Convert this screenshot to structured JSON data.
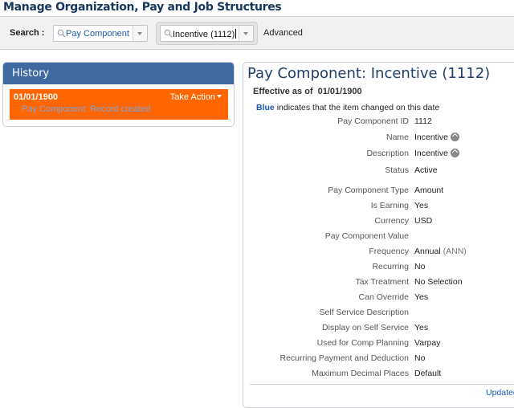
{
  "page": {
    "title": "Manage Organization, Pay and Job Structures"
  },
  "search": {
    "label": "Search :",
    "type_value": "Pay Component",
    "item_value": "Incentive (1112)",
    "advanced_label": "Advanced"
  },
  "history": {
    "title": "History",
    "entry": {
      "date": "01/01/1900",
      "action_label": "Take Action",
      "description": "Pay Component: Record created"
    }
  },
  "detail": {
    "title": "Pay Component: Incentive (1112)",
    "effective_label": "Effective as of",
    "effective_date": "01/01/1900",
    "legend_blue": "Blue",
    "legend_text": "indicates that the item changed on this date",
    "rows": [
      {
        "label": "Pay Component ID",
        "value": "1112"
      },
      {
        "label": "Name",
        "value": "Incentive"
      },
      {
        "label": "Description",
        "value": "Incentive"
      },
      {
        "label": "Status",
        "value": "Active"
      },
      {
        "label": "Pay Component Type",
        "value": "Amount"
      },
      {
        "label": "Is Earning",
        "value": "Yes"
      },
      {
        "label": "Currency",
        "value": "USD"
      },
      {
        "label": "Pay Component Value",
        "value": ""
      },
      {
        "label": "Frequency",
        "value": "Annual",
        "code": "(ANN)"
      },
      {
        "label": "Recurring",
        "value": "No"
      },
      {
        "label": "Tax Treatment",
        "value": "No Selection"
      },
      {
        "label": "Can Override",
        "value": "Yes"
      },
      {
        "label": "Self Service Description",
        "value": ""
      },
      {
        "label": "Display on Self Service",
        "value": "Yes"
      },
      {
        "label": "Used for Comp Planning",
        "value": "Varpay"
      },
      {
        "label": "Recurring Payment and Deduction",
        "value": "No"
      },
      {
        "label": "Maximum Decimal Places",
        "value": "Default"
      }
    ],
    "updated_label": "Updated"
  }
}
